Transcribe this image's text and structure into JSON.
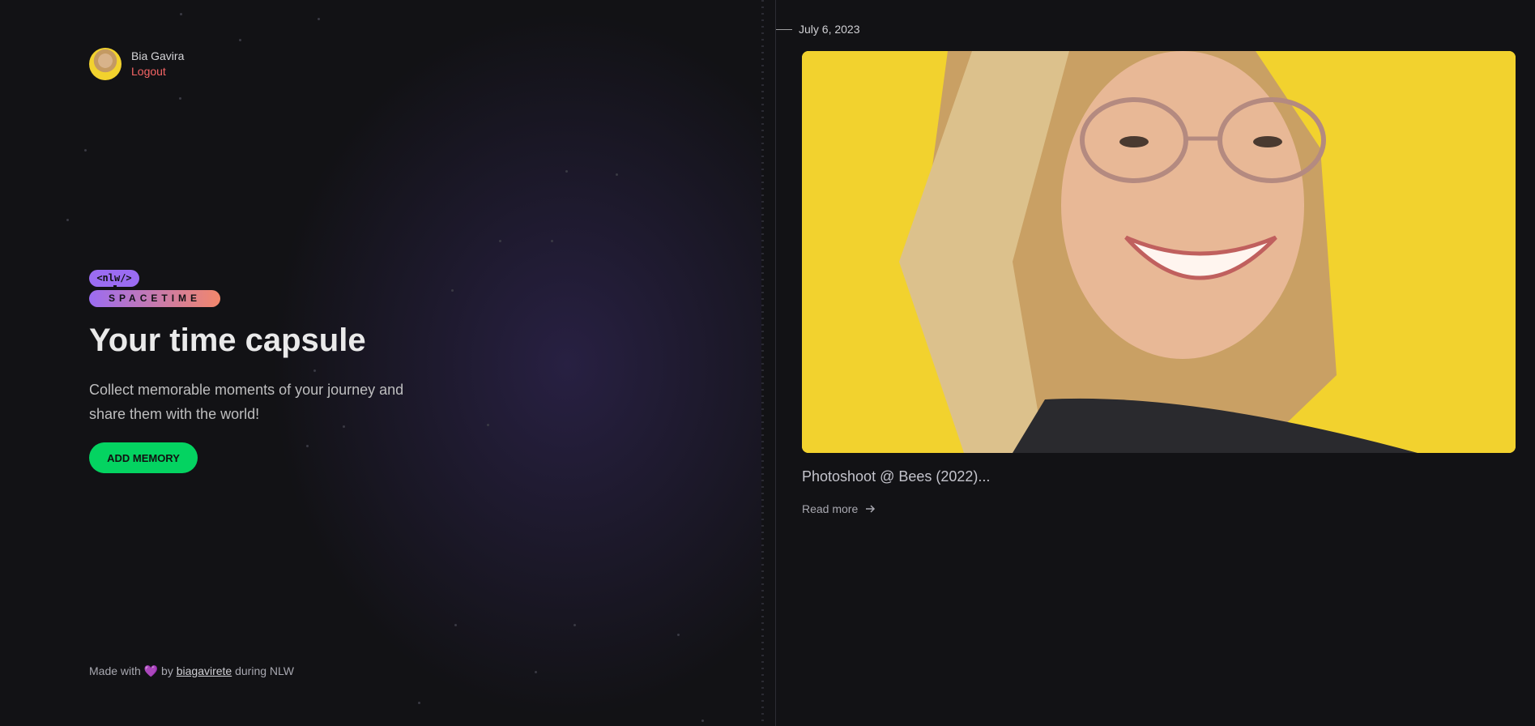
{
  "user": {
    "name": "Bia Gavira",
    "logout_label": "Logout",
    "avatar_alt": "avatar"
  },
  "logo": {
    "top": "<nlw/>",
    "bottom": "SPACETIME"
  },
  "hero": {
    "title": "Your time capsule",
    "description": "Collect memorable moments of your journey and share them with the world!",
    "button_label": "ADD MEMORY"
  },
  "footer": {
    "prefix": "Made with",
    "heart": "💜",
    "by": "by",
    "author": "biagavirete",
    "suffix": "during NLW"
  },
  "memory": {
    "date": "July 6, 2023",
    "image_icon": "photo",
    "excerpt": "Photoshoot @ Bees (2022)...",
    "read_more": "Read more",
    "read_more_icon": "arrow-right-icon"
  },
  "colors": {
    "accent_green": "#04d361",
    "logout_red": "#f56565",
    "purple": "#9b6cf2",
    "orange": "#f2876b",
    "photo_bg": "#f2d22e"
  }
}
